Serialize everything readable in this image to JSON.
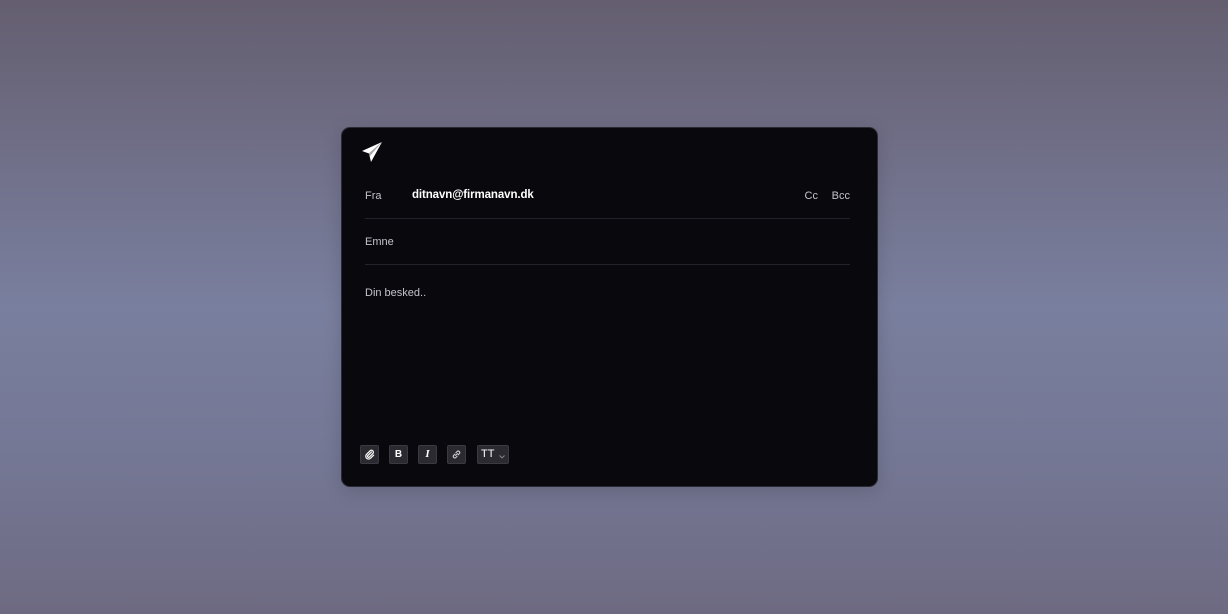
{
  "composer": {
    "from_label": "Fra",
    "from_value": "ditnavn@firmanavn.dk",
    "cc_label": "Cc",
    "bcc_label": "Bcc",
    "subject_label": "Emne",
    "body_placeholder": "Din besked..",
    "toolbar": {
      "bold_label": "B",
      "italic_label": "I",
      "font_size_label": "TT"
    }
  },
  "icons": {
    "send": "paper-plane-icon",
    "attach": "paperclip-icon",
    "link": "link-icon",
    "dropdown": "chevron-down-icon"
  },
  "colors": {
    "panel_bg": "#09080d",
    "text_primary": "#ffffff",
    "text_secondary": "#c4c3cc",
    "button_bg": "#2a2a30"
  }
}
